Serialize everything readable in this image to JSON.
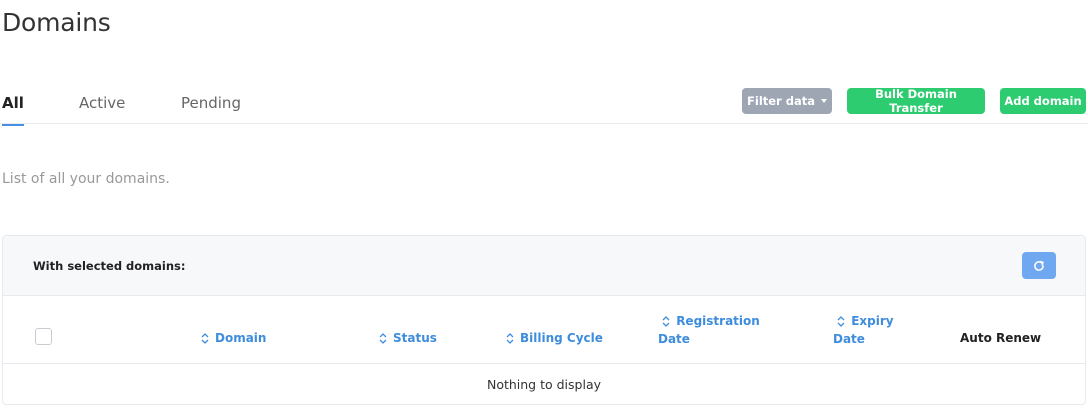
{
  "page": {
    "title": "Domains",
    "description": "List of all your domains."
  },
  "tabs": [
    {
      "label": "All",
      "active": true
    },
    {
      "label": "Active",
      "active": false
    },
    {
      "label": "Pending",
      "active": false
    }
  ],
  "actions": {
    "filter_label": "Filter data",
    "bulk_transfer_label": "Bulk Domain Transfer",
    "add_domain_label": "Add domain"
  },
  "table": {
    "selection_label": "With selected domains:",
    "columns": {
      "domain": "Domain",
      "status": "Status",
      "billing_cycle": "Billing Cycle",
      "registration_line1": "Registration",
      "registration_line2": "Date",
      "expiry_line1": "Expiry",
      "expiry_line2": "Date",
      "auto_renew": "Auto Renew"
    },
    "empty_message": "Nothing to display"
  },
  "colors": {
    "accent": "#3e8ddd",
    "success": "#2ecc71",
    "filter_button": "#9ea6b4",
    "refresh_button": "#6fa8f0"
  },
  "icons": {
    "refresh": "refresh-icon",
    "sort": "sort-icon",
    "caret": "caret-down-icon"
  }
}
